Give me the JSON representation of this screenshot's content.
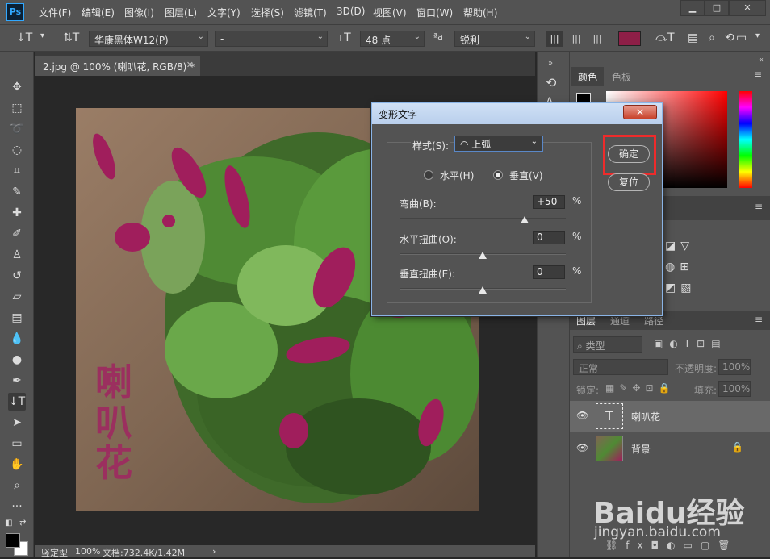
{
  "app": {
    "logo": "Ps"
  },
  "menu": [
    "文件(F)",
    "编辑(E)",
    "图像(I)",
    "图层(L)",
    "文字(Y)",
    "选择(S)",
    "滤镜(T)",
    "3D(D)",
    "视图(V)",
    "窗口(W)",
    "帮助(H)"
  ],
  "options": {
    "font_family": "华康黑体W12(P)",
    "font_style": "-",
    "font_size": "48 点",
    "aa_label": "ªa",
    "antialias": "锐利",
    "text_color": "#8e1f47"
  },
  "document": {
    "tab_title": "2.jpg @ 100% (喇叭花, RGB/8) *",
    "layer_text": [
      "喇",
      "叭",
      "花"
    ],
    "text_color": "#9b2f5f"
  },
  "status": {
    "zoom": "100%",
    "doc_info": "文档:732.4K/1.42M",
    "bottom_left": "竖定型"
  },
  "dialog": {
    "title": "变形文字",
    "style_label": "样式(S):",
    "style_value": "上弧",
    "horizontal_label": "水平(H)",
    "vertical_label": "垂直(V)",
    "orientation": "vertical",
    "bend_label": "弯曲(B):",
    "bend_value": "+50",
    "bend": 50,
    "hdist_label": "水平扭曲(O):",
    "hdist_value": "0",
    "hdist": 0,
    "vdist_label": "垂直扭曲(E):",
    "vdist_value": "0",
    "vdist": 0,
    "percent": "%",
    "ok": "确定",
    "reset": "复位"
  },
  "color_panel": {
    "tabs": [
      "颜色",
      "色板"
    ]
  },
  "layers_panel": {
    "tabs": [
      "图层",
      "通道",
      "路径"
    ],
    "filter_label": "类型",
    "blend_mode": "正常",
    "opacity_label": "不透明度:",
    "opacity_value": "100%",
    "lock_label": "锁定:",
    "fill_label": "填充:",
    "fill_value": "100%",
    "layers": [
      {
        "name": "喇叭花",
        "type": "text"
      },
      {
        "name": "背景",
        "type": "image"
      }
    ]
  },
  "watermark": {
    "text": "Baidu经验",
    "url": "jingyan.baidu.com"
  }
}
